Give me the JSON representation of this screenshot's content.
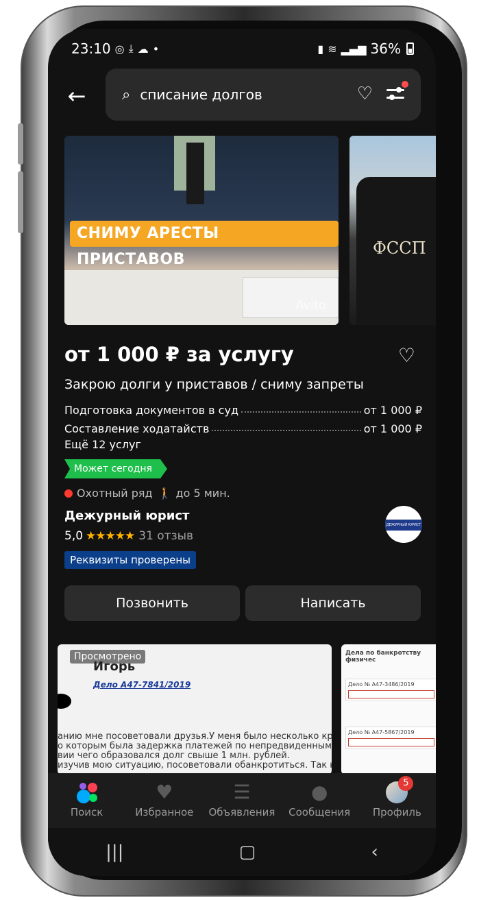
{
  "status_bar": {
    "time": "23:10",
    "battery": "36%"
  },
  "search": {
    "query": "списание долгов"
  },
  "gallery": {
    "banner_text": "СНИМУ АРЕСТЫ ПРИСТАВОВ",
    "watermark": "Avito",
    "second_image_label": "ФССП"
  },
  "listing": {
    "price": "от 1 000 ₽ за услугу",
    "title": "Закрою долги у приставов / сниму запреты",
    "services": [
      {
        "name": "Подготовка документов в суд",
        "price": "от 1 000 ₽"
      },
      {
        "name": "Составление ходатайств",
        "price": "от 1 000 ₽"
      }
    ],
    "more_services": "Ещё 12 услуг",
    "badge": "Может сегодня",
    "metro": "Охотный ряд",
    "walk_time": "до 5 мин.",
    "seller": "Дежурный юрист",
    "rating": "5,0",
    "stars": "★★★★★",
    "reviews": "31 отзыв",
    "verified": "Реквизиты проверены",
    "avatar_text": "ДЕЖУРНЫЙ ЮРИСТ"
  },
  "actions": {
    "call": "Позвонить",
    "message": "Написать"
  },
  "next_card": {
    "viewed": "Просмотрено",
    "name": "Игорь",
    "case": "Дело А47-7841/2019",
    "lines": [
      "анию мне посоветовали друзья.У меня было несколько кредитов в",
      "о которым была задержка платежей по непредвиденным обстояте",
      "вии чего образовался долг свыше 1 млн. рублей.",
      "изучив мою ситуацию, посоветовали обанкротиться. Так как в этом"
    ],
    "side_header": "Дела по банкротству физичес",
    "side_cases": [
      "Дело № А47-3486/2019",
      "Дело № А47-5867/2019"
    ]
  },
  "bottom_nav": [
    {
      "label": "Поиск",
      "icon": "avito-logo-icon"
    },
    {
      "label": "Избранное",
      "icon": "heart-icon"
    },
    {
      "label": "Объявления",
      "icon": "ads-icon"
    },
    {
      "label": "Сообщения",
      "icon": "chat-icon"
    },
    {
      "label": "Профиль",
      "icon": "profile-icon",
      "badge": "5"
    }
  ],
  "colors": {
    "accent_green": "#1fbf4c",
    "banner_orange": "#f5a623",
    "verified_blue": "#0b3f8a",
    "star": "#ffb400"
  }
}
